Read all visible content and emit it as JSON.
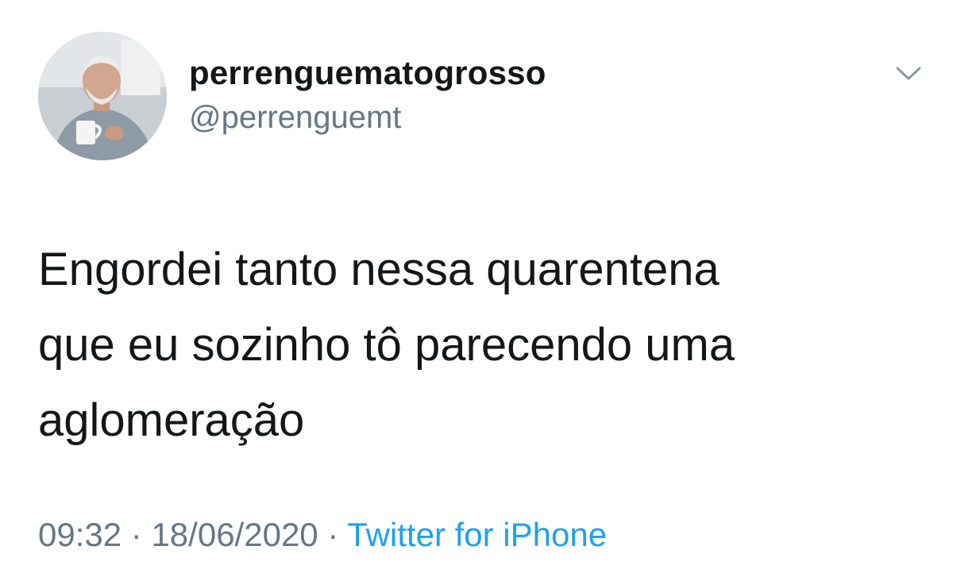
{
  "tweet": {
    "author": {
      "display_name": "perrenguematogrosso",
      "handle": "@perrenguemt"
    },
    "text": "Engordei tanto nessa quarentena\nque eu sozinho tô parecendo uma\naglomeração",
    "time": "09:32",
    "separator": "·",
    "date": "18/06/2020",
    "source": "Twitter for iPhone"
  },
  "colors": {
    "text": "#14171a",
    "secondary": "#657786",
    "link": "#1da1f2"
  },
  "icons": {
    "menu": "chevron-down-icon",
    "avatar": "avatar-photo"
  }
}
